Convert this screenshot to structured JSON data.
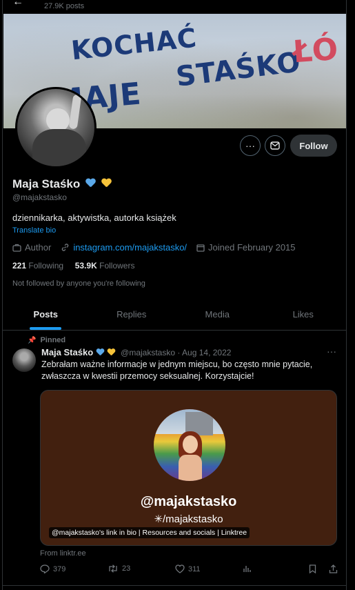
{
  "header": {
    "back_glyph": "←",
    "posts_count": "27.9K posts"
  },
  "banner": {
    "line1": "KOCHAĆ",
    "line2": "MAJE",
    "line3": "STAŚKO",
    "side": "ŁÓ"
  },
  "profile": {
    "name": "Maja Staśko",
    "handle": "@majakstasko",
    "bio": "dziennikarka, aktywistka, autorka książek",
    "translate": "Translate bio",
    "category": "Author",
    "link": "instagram.com/majakstasko/",
    "joined": "Joined February 2015",
    "following_count": "221",
    "following_label": "Following",
    "followers_count": "53.9K",
    "followers_label": "Followers",
    "not_followed": "Not followed by anyone you're following"
  },
  "actions": {
    "more": "···",
    "follow": "Follow"
  },
  "tabs": [
    {
      "label": "Posts"
    },
    {
      "label": "Replies"
    },
    {
      "label": "Media"
    },
    {
      "label": "Likes"
    }
  ],
  "tweet": {
    "pinned": "Pinned",
    "name": "Maja Staśko",
    "handle_date": "@majakstasko · Aug 14, 2022",
    "text": "Zebrałam ważne informacje w jednym miejscu, bo często mnie pytacie, zwłaszcza w kwestii przemocy seksualnej. Korzystajcie!",
    "card_title": "@majakstasko",
    "card_sub": "✳/majakstasko",
    "card_label": "@majakstasko's link in bio | Resources and socials | Linktree",
    "from": "From linktr.ee",
    "replies": "379",
    "reposts": "23",
    "likes": "311"
  },
  "colors": {
    "accent": "#1d9bf0",
    "background": "#000000",
    "card_bg": "#42200f",
    "heart_blue": "#5ba9ea",
    "heart_yellow": "#f6c33a"
  }
}
